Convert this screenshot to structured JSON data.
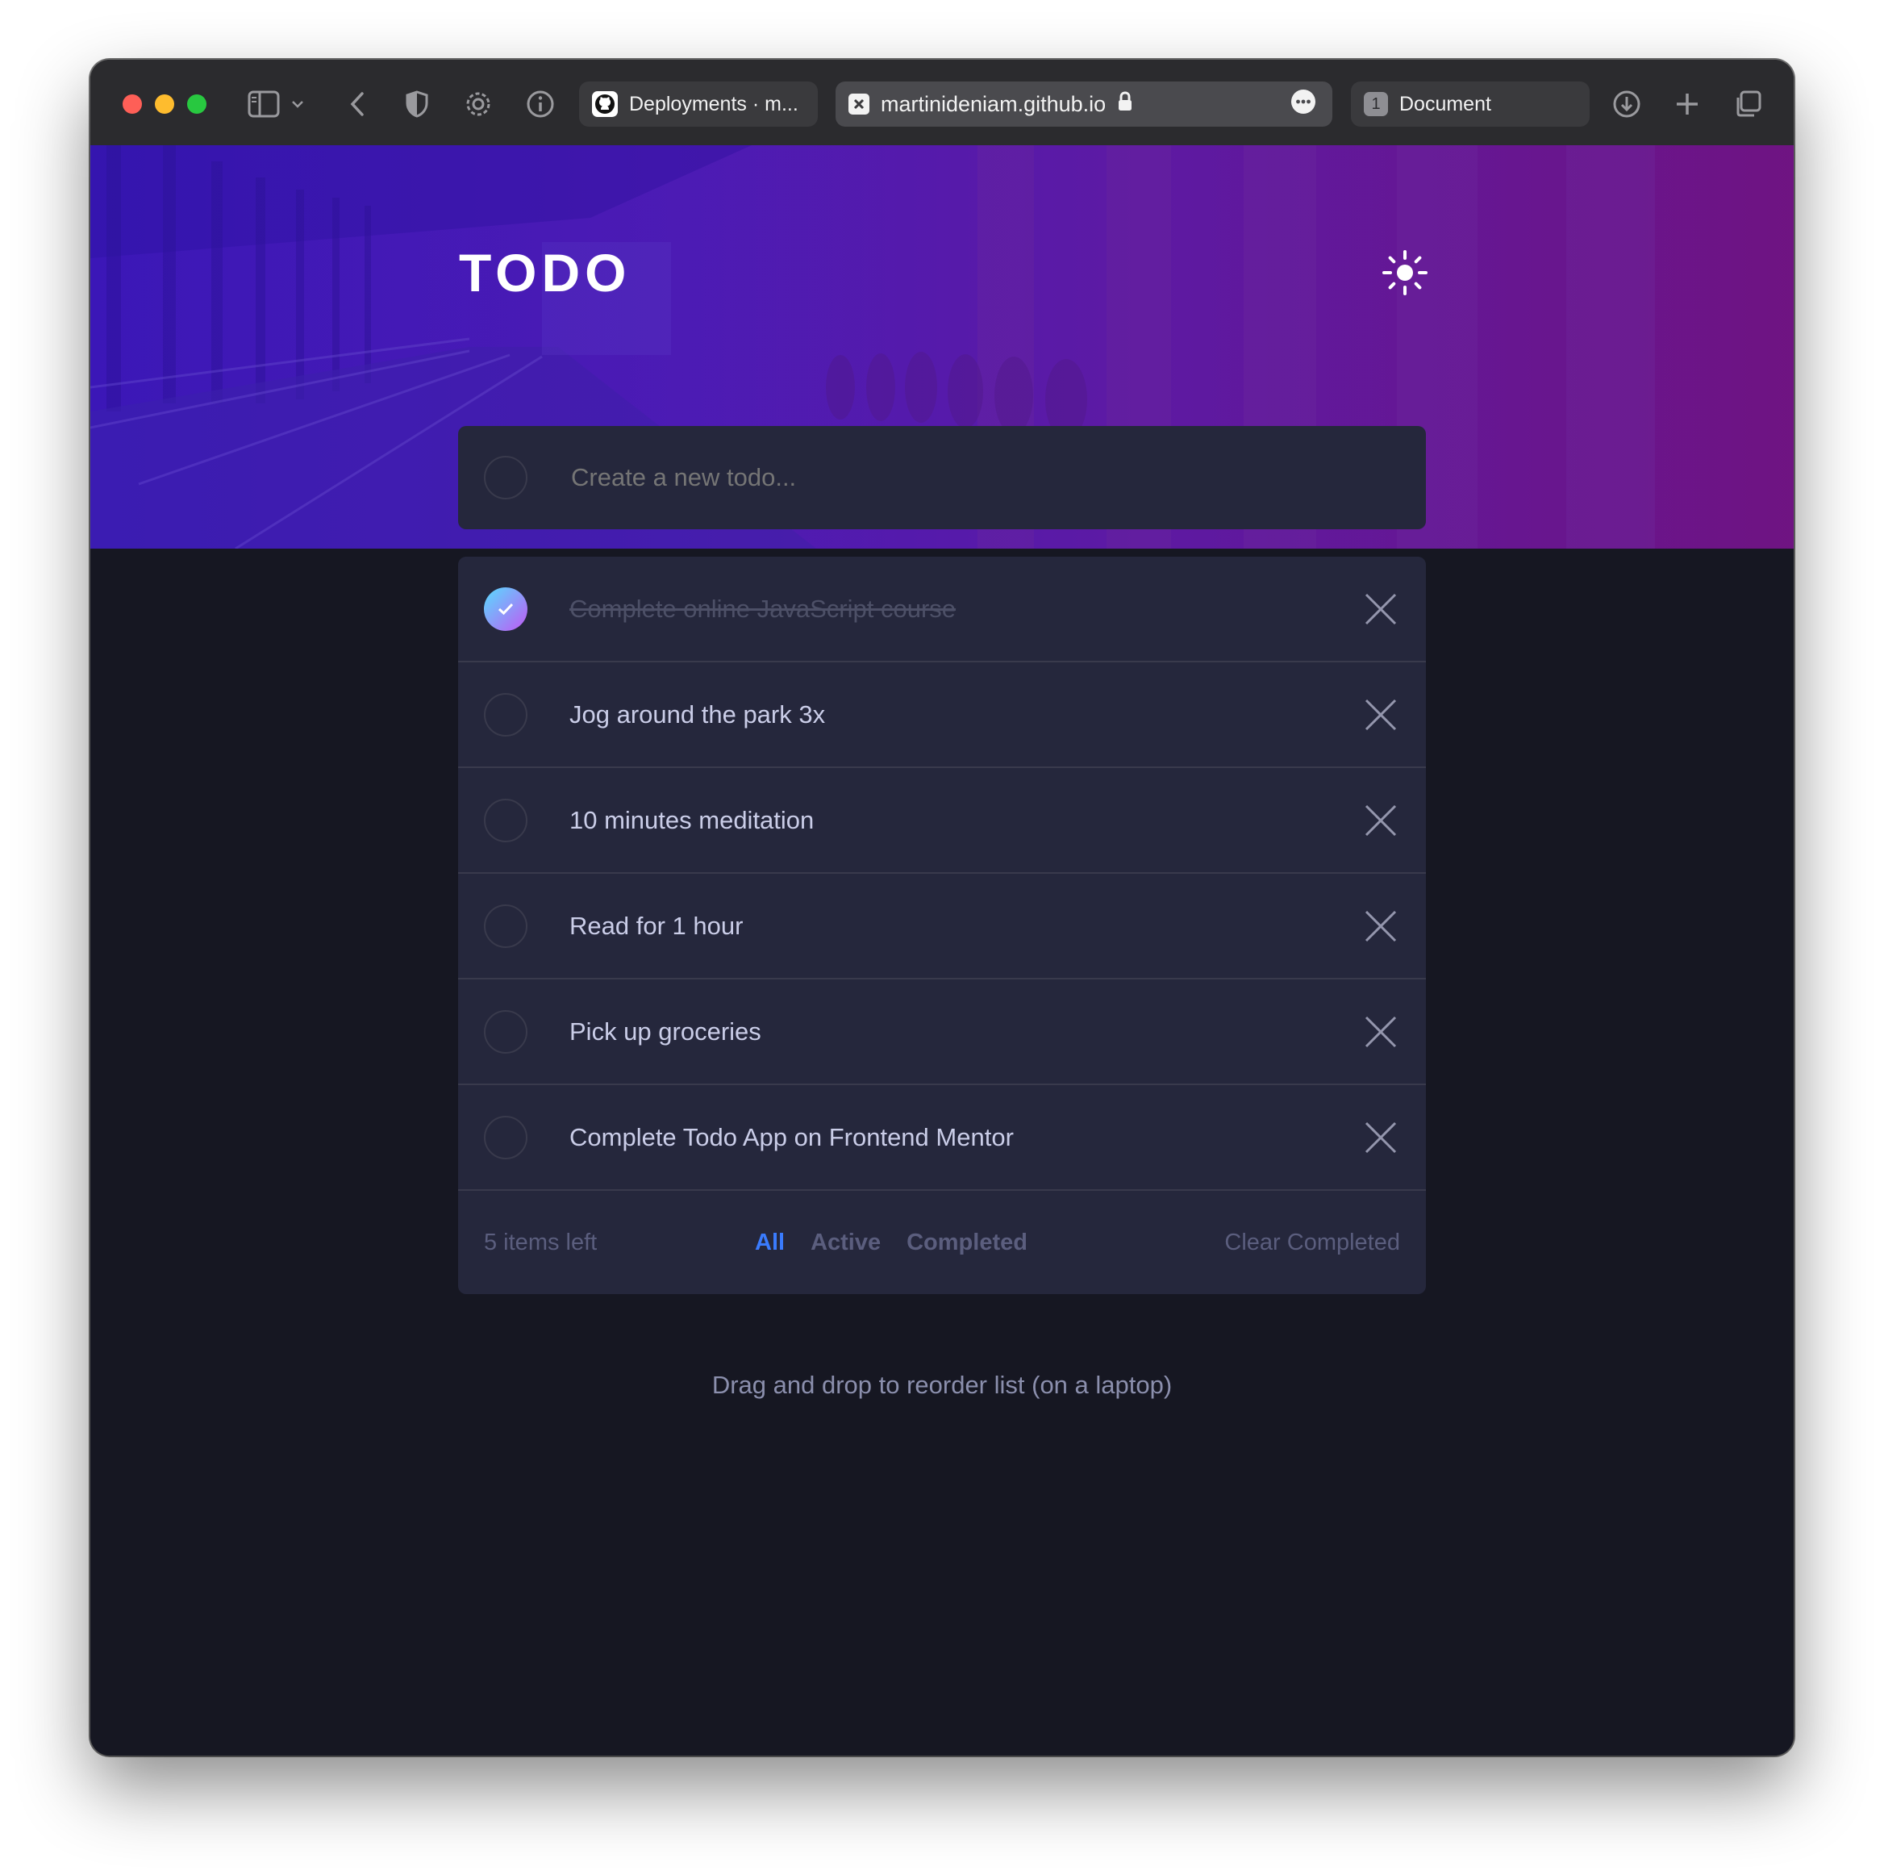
{
  "browser": {
    "tabs": [
      {
        "label": "Deployments · m...",
        "icon": "github-icon"
      },
      {
        "label": "martinideniam.github.io",
        "icon": "site-icon",
        "secure": true
      },
      {
        "label": "Document",
        "icon": "document-icon",
        "badge": "1"
      }
    ],
    "traffic_colors": {
      "close": "#fe5f57",
      "minimize": "#febc2e",
      "maximize": "#28c840"
    }
  },
  "app": {
    "title": "TODO",
    "theme_icon": "sun-icon",
    "new_todo_placeholder": "Create a new todo...",
    "todos": [
      {
        "text": "Complete online JavaScript course",
        "completed": true
      },
      {
        "text": "Jog around the park 3x",
        "completed": false
      },
      {
        "text": "10 minutes meditation",
        "completed": false
      },
      {
        "text": "Read for 1 hour",
        "completed": false
      },
      {
        "text": "Pick up groceries",
        "completed": false
      },
      {
        "text": "Complete Todo App on Frontend Mentor",
        "completed": false
      }
    ],
    "footer": {
      "items_left": "5 items left",
      "filters": [
        "All",
        "Active",
        "Completed"
      ],
      "active_filter": "All",
      "clear_label": "Clear Completed"
    },
    "hint": "Drag and drop to reorder list (on a laptop)",
    "colors": {
      "accent": "#3a7bfd",
      "check_gradient_start": "#57ddff",
      "check_gradient_end": "#c058f3",
      "card": "#25273c",
      "background": "#161722"
    }
  }
}
